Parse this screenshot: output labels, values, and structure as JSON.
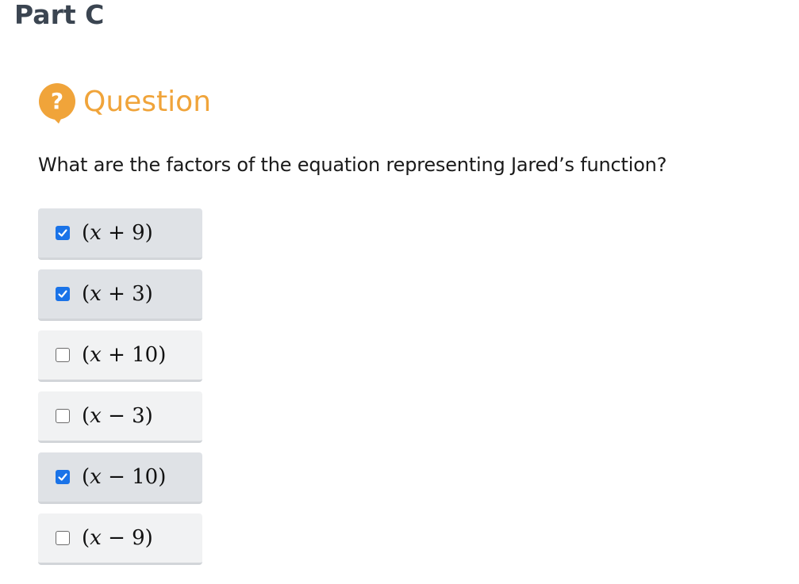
{
  "part": {
    "title": "Part C"
  },
  "question": {
    "header_label": "Question",
    "icon": "question-mark-speech-bubble-icon",
    "prompt": "What are the factors of the equation representing Jared’s function?"
  },
  "options": [
    {
      "open": "(",
      "var": "x",
      "rest": " + 9)",
      "checked": true
    },
    {
      "open": "(",
      "var": "x",
      "rest": " + 3)",
      "checked": true
    },
    {
      "open": "(",
      "var": "x",
      "rest": " + 10)",
      "checked": false
    },
    {
      "open": "(",
      "var": "x",
      "rest": " − 3)",
      "checked": false
    },
    {
      "open": "(",
      "var": "x",
      "rest": " − 10)",
      "checked": true
    },
    {
      "open": "(",
      "var": "x",
      "rest": " − 9)",
      "checked": false
    }
  ],
  "colors": {
    "accent_orange": "#f0a43a",
    "checkbox_blue": "#1a73e8",
    "checked_bg": "#dfe2e6",
    "unchecked_bg": "#f1f2f3"
  }
}
